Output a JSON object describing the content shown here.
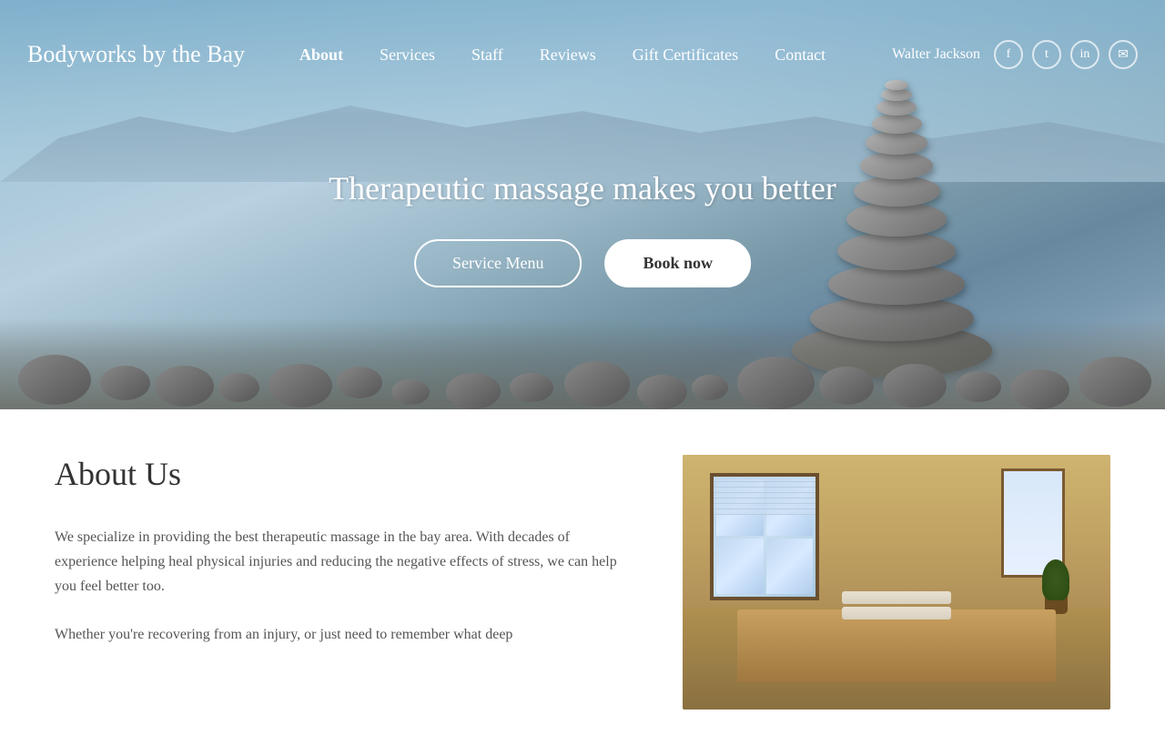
{
  "site": {
    "title": "Bodyworks by the Bay"
  },
  "nav": {
    "links": [
      {
        "id": "about",
        "label": "About",
        "active": true
      },
      {
        "id": "services",
        "label": "Services",
        "active": false
      },
      {
        "id": "staff",
        "label": "Staff",
        "active": false
      },
      {
        "id": "reviews",
        "label": "Reviews",
        "active": false
      },
      {
        "id": "gift-certificates",
        "label": "Gift Certificates",
        "active": false
      },
      {
        "id": "contact",
        "label": "Contact",
        "active": false
      }
    ],
    "user": "Walter Jackson"
  },
  "social": {
    "facebook": "f",
    "twitter": "t",
    "linkedin": "in",
    "email": "✉"
  },
  "hero": {
    "headline": "Therapeutic massage makes you better",
    "service_menu_label": "Service Menu",
    "book_now_label": "Book now"
  },
  "about": {
    "title": "About Us",
    "paragraph1": "We specialize in providing the best therapeutic massage in the bay area. With decades of experience helping heal physical injuries and reducing the negative effects of stress,  we can help you feel better too.",
    "paragraph2": "Whether you're recovering from an injury, or just need to remember what deep"
  }
}
